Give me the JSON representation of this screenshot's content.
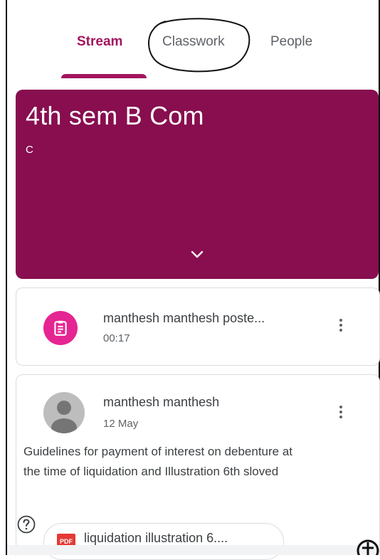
{
  "tabs": {
    "stream": "Stream",
    "classwork": "Classwork",
    "people": "People",
    "active": "stream"
  },
  "class_banner": {
    "title": "4th sem B Com",
    "section": "C",
    "color": "#880e4f",
    "expand_icon": "chevron-down-icon"
  },
  "posts": [
    {
      "icon": "assignment-icon",
      "icon_color": "#e52592",
      "title": "manthesh manthesh poste...",
      "time": "00:17",
      "menu_icon": "more-vert-icon"
    },
    {
      "author": "manthesh manthesh",
      "date": "12 May",
      "body": "Guidelines for payment of interest on debenture at the time of liquidation and Illustration 6th sloved",
      "attachment": {
        "type_label": "PDF",
        "name": "liquidation illustration 6...."
      },
      "menu_icon": "more-vert-icon"
    }
  ],
  "help_icon": "help-icon",
  "accent_color": "#a3155e"
}
